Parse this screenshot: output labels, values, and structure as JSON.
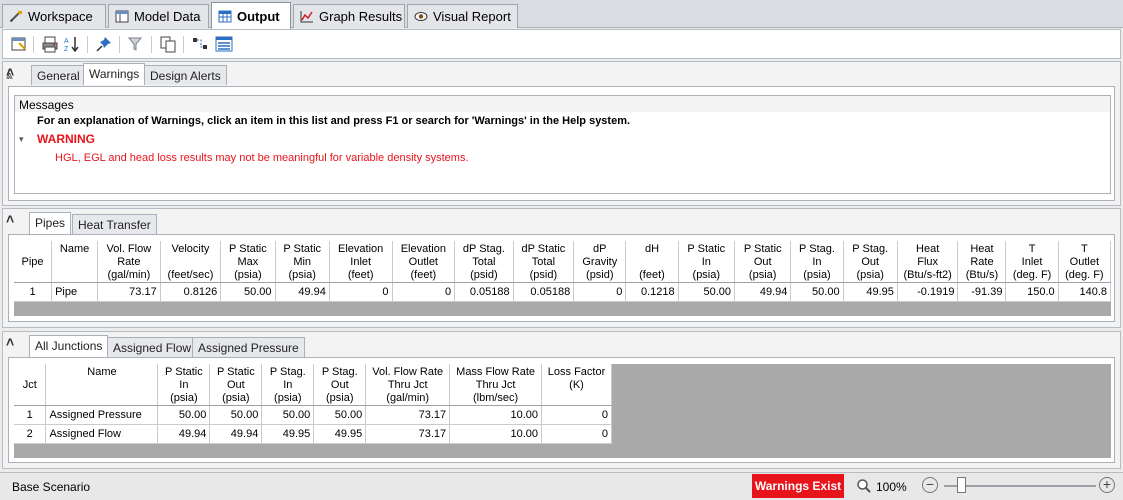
{
  "main_tabs": [
    {
      "label": "Workspace",
      "icon": "workspace-icon"
    },
    {
      "label": "Model Data",
      "icon": "model-data-icon"
    },
    {
      "label": "Output",
      "icon": "output-table-icon"
    },
    {
      "label": "Graph Results",
      "icon": "graph-icon"
    },
    {
      "label": "Visual Report",
      "icon": "eye-icon"
    }
  ],
  "toolbar": {
    "icons": [
      "customize-icon",
      "print-icon",
      "sort-icon",
      "pin-icon",
      "filter-icon",
      "copy-icon",
      "diagram-icon",
      "list-icon"
    ]
  },
  "warnings_panel": {
    "tabs": [
      "General",
      "Warnings",
      "Design Alerts"
    ],
    "active_tab": "Warnings",
    "messages_header": "Messages",
    "instruction": "For an explanation of Warnings, click an item in this list and press F1 or search for 'Warnings' in the Help system.",
    "warning_title": "WARNING",
    "warning_text": "HGL, EGL and head loss results may not be meaningful for variable density systems."
  },
  "pipes_panel": {
    "tabs": [
      "Pipes",
      "Heat Transfer"
    ],
    "active_tab": "Pipes",
    "headers": [
      "Pipe",
      "Name",
      "Vol. Flow\nRate\n(gal/min)",
      "Velocity\n\n(feet/sec)",
      "P Static\nMax\n(psia)",
      "P Static\nMin\n(psia)",
      "Elevation\nInlet\n(feet)",
      "Elevation\nOutlet\n(feet)",
      "dP Stag.\nTotal\n(psid)",
      "dP Static\nTotal\n(psid)",
      "dP\nGravity\n(psid)",
      "dH\n\n(feet)",
      "P Static\nIn\n(psia)",
      "P Static\nOut\n(psia)",
      "P Stag.\nIn\n(psia)",
      "P Stag.\nOut\n(psia)",
      "Heat\nFlux\n(Btu/s-ft2)",
      "Heat\nRate\n(Btu/s)",
      "T\nInlet\n(deg. F)",
      "T\nOutlet\n(deg. F)"
    ],
    "rows": [
      [
        "1",
        "Pipe",
        "73.17",
        "0.8126",
        "50.00",
        "49.94",
        "0",
        "0",
        "0.05188",
        "0.05188",
        "0",
        "0.1218",
        "50.00",
        "49.94",
        "50.00",
        "49.95",
        "-0.1919",
        "-91.39",
        "150.0",
        "140.8"
      ]
    ]
  },
  "junctions_panel": {
    "tabs": [
      "All Junctions",
      "Assigned Flow",
      "Assigned Pressure"
    ],
    "active_tab": "All Junctions",
    "headers": [
      "Jct",
      "Name",
      "P Static\nIn\n(psia)",
      "P Static\nOut\n(psia)",
      "P Stag.\nIn\n(psia)",
      "P Stag.\nOut\n(psia)",
      "Vol. Flow Rate\nThru Jct\n(gal/min)",
      "Mass Flow Rate\nThru Jct\n(lbm/sec)",
      "Loss Factor\n(K)"
    ],
    "rows": [
      [
        "1",
        "Assigned Pressure",
        "50.00",
        "50.00",
        "50.00",
        "50.00",
        "73.17",
        "10.00",
        "0"
      ],
      [
        "2",
        "Assigned Flow",
        "49.94",
        "49.94",
        "49.95",
        "49.95",
        "73.17",
        "10.00",
        "0"
      ]
    ]
  },
  "status_bar": {
    "scenario": "Base Scenario",
    "warning_badge": "Warnings Exist",
    "zoom": "100%",
    "colors": {
      "warning_bg": "#e8141c",
      "warning_text": "#ffffff"
    }
  },
  "colors": {
    "warning_red": "#e8141c",
    "accent": "#2b6fc2"
  }
}
